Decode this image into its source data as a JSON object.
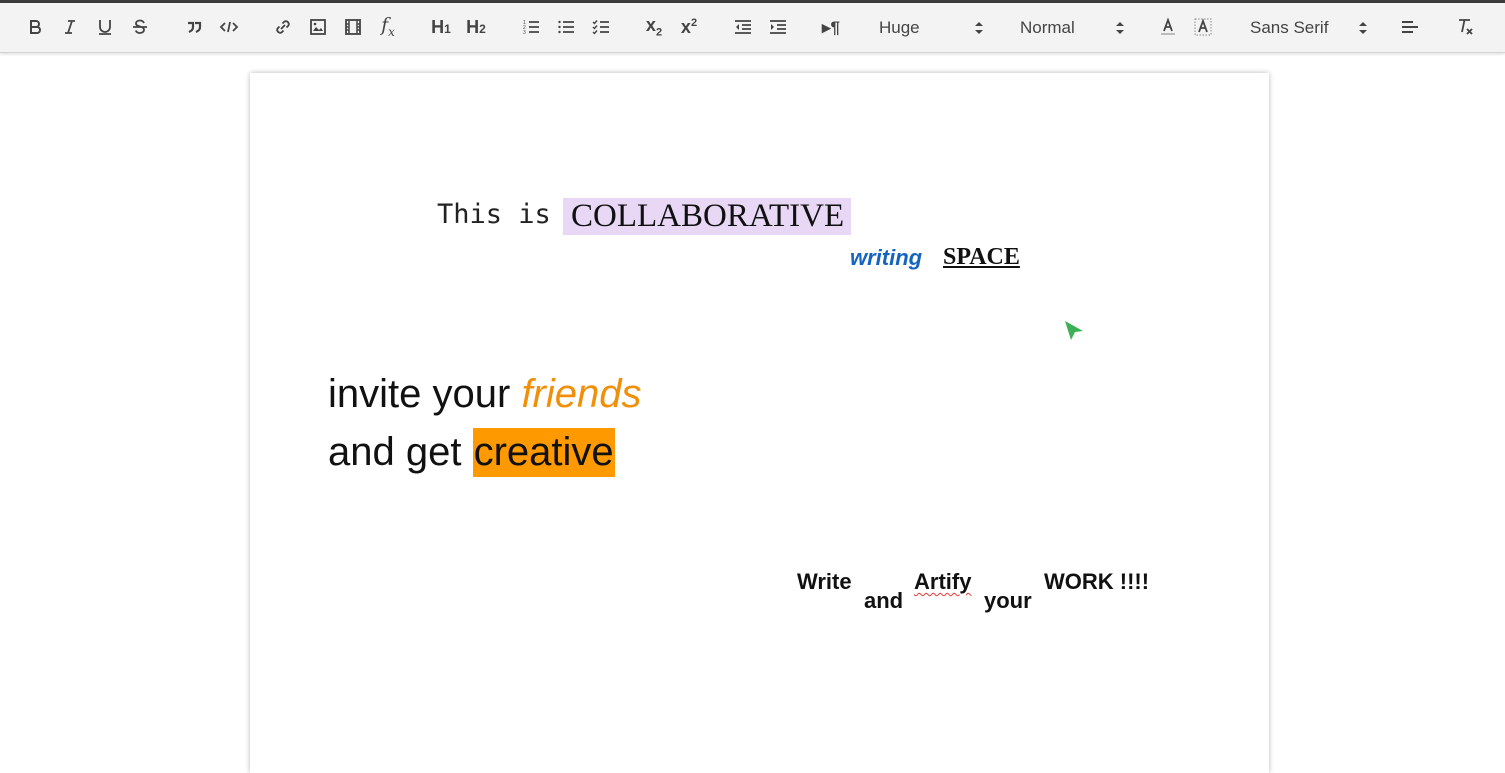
{
  "toolbar": {
    "size_value": "Huge",
    "header_value": "Normal",
    "font_value": "Sans Serif"
  },
  "colors": {
    "collab_bg": "#e8d8f6",
    "writing": "#1565c0",
    "friends": "#f0900a",
    "creative_bg": "#ff9900",
    "cursor": "#3cb054"
  },
  "doc": {
    "line1_prefix": "This is",
    "line1_highlight": "COLLABORATIVE",
    "writing": "writing",
    "space": "SPACE",
    "invite": "invite your",
    "friends": "friends",
    "and_get": "and get",
    "creative": "creative",
    "write": "Write",
    "and": "and",
    "artify": "Artify",
    "your": "your",
    "work": "WORK !!!!"
  }
}
